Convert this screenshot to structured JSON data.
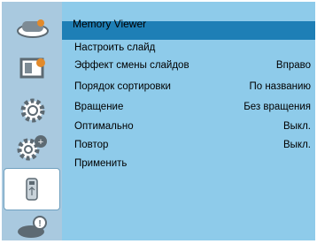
{
  "panel": {
    "title": "Memory Viewer"
  },
  "sidebar": {
    "tabs": [
      {
        "icon": "display-settings-icon"
      },
      {
        "icon": "picture-adjust-icon"
      },
      {
        "icon": "gear-icon"
      },
      {
        "icon": "advanced-gear-icon"
      },
      {
        "icon": "usb-memory-icon",
        "active": true
      },
      {
        "icon": "info-icon"
      }
    ]
  },
  "menu": {
    "items": [
      {
        "label": "Настроить слайд",
        "value": ""
      },
      {
        "label": "Эффект смены слайдов",
        "value": "Вправо"
      },
      {
        "label": "Порядок сортировки",
        "value": "По названию"
      },
      {
        "label": "Вращение",
        "value": "Без вращения"
      },
      {
        "label": "Оптимально",
        "value": "Выкл."
      },
      {
        "label": "Повтор",
        "value": "Выкл."
      },
      {
        "label": "Применить",
        "value": ""
      }
    ]
  },
  "colors": {
    "sidebar_bg": "#a9c9df",
    "panel_bg": "#8ecbea",
    "header_bg": "#1e7fb6",
    "icon_gray": "#5d6a73",
    "accent_orange": "#e28a2b"
  }
}
